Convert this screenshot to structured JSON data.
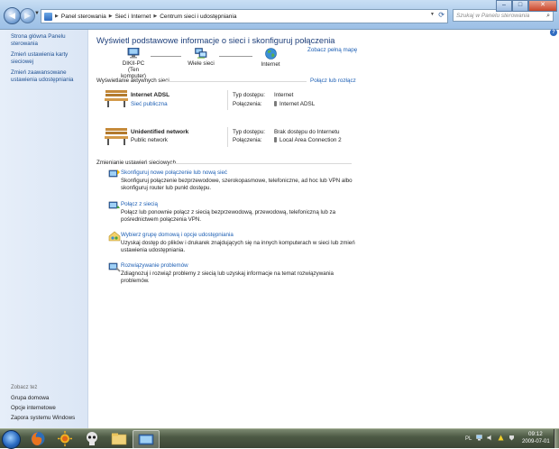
{
  "breadcrumb": [
    "Panel sterowania",
    "Sieć i Internet",
    "Centrum sieci i udostępniania"
  ],
  "search": {
    "placeholder": "Szukaj w Panelu sterowania"
  },
  "window_buttons": {
    "minimize": "–",
    "maximize": "□",
    "close": "✕"
  },
  "left_pane": {
    "links": [
      "Strona główna Panelu sterowania",
      "Zmień ustawienia karty sieciowej",
      "Zmień zaawansowane ustawienia udostępniania"
    ],
    "see_also_title": "Zobacz też",
    "see_also": [
      "Grupa domowa",
      "Opcje internetowe",
      "Zapora systemu Windows"
    ]
  },
  "main": {
    "title": "Wyświetl podstawowe informacje o sieci i skonfiguruj połączenia",
    "full_map_link": "Zobacz pełną mapę",
    "map_nodes": [
      {
        "label": "DIKII-PC",
        "sublabel": "(Ten komputer)",
        "icon": "computer-icon"
      },
      {
        "label": "Wiele sieci",
        "icon": "multiple-networks-icon"
      },
      {
        "label": "Internet",
        "icon": "globe-icon"
      }
    ],
    "active_networks_title": "Wyświetlanie aktywnych sieci",
    "connect_link": "Połącz lub rozłącz",
    "networks": [
      {
        "name": "Internet ADSL",
        "type": "Sieć publiczna",
        "type_is_link": true,
        "access_label": "Typ dostępu:",
        "access_value": "Internet",
        "connections_label": "Połączenia:",
        "connections_value": "Internet ADSL"
      },
      {
        "name": "Unidentified network",
        "type": "Public network",
        "type_is_link": false,
        "access_label": "Typ dostępu:",
        "access_value": "Brak dostępu do Internetu",
        "connections_label": "Połączenia:",
        "connections_value": "Local Area Connection 2"
      }
    ],
    "change_settings_title": "Zmienianie ustawień sieciowych",
    "tasks": [
      {
        "title": "Skonfiguruj nowe połączenie lub nową sieć",
        "desc": "Skonfiguruj połączenie bezprzewodowe, szerokopasmowe, telefoniczne, ad hoc lub VPN albo skonfiguruj router lub punkt dostępu.",
        "icon": "new-connection-icon"
      },
      {
        "title": "Połącz z siecią",
        "desc": "Połącz lub ponownie połącz z siecią bezprzewodową, przewodową, telefoniczną lub za pośrednictwem połączenia VPN.",
        "icon": "connect-network-icon"
      },
      {
        "title": "Wybierz grupę domową i opcje udostępniania",
        "desc": "Uzyskaj dostęp do plików i drukarek znajdujących się na innych komputerach w sieci lub zmień ustawienia udostępniania.",
        "icon": "homegroup-icon"
      },
      {
        "title": "Rozwiązywanie problemów",
        "desc": "Zdiagnozuj i rozwiąż problemy z siecią lub uzyskaj informacje na temat rozwiązywania problemów.",
        "icon": "troubleshoot-icon"
      }
    ]
  },
  "taskbar": {
    "items": [
      "firefox-icon",
      "sun-app-icon",
      "skull-app-icon",
      "explorer-folder-icon",
      "network-center-window-icon"
    ],
    "language": "PL",
    "time": "09:12",
    "date": "2009-07-01"
  }
}
